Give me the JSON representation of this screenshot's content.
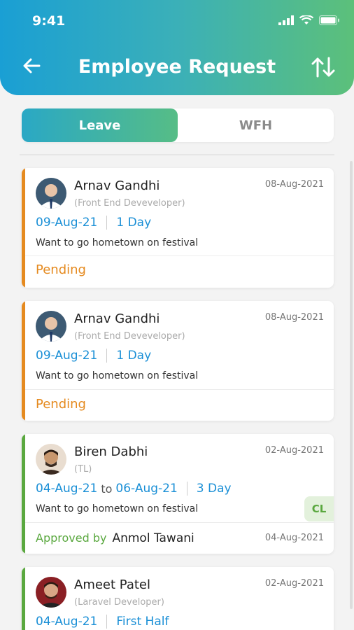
{
  "status_bar": {
    "time": "9:41"
  },
  "header": {
    "title": "Employee Request"
  },
  "tabs": [
    {
      "label": "Leave",
      "active": true
    },
    {
      "label": "WFH",
      "active": false
    }
  ],
  "colors": {
    "pending": "#e58a1f",
    "approved": "#5aa83f",
    "date_blue": "#1a8fd6"
  },
  "requests": [
    {
      "name": "Arnav Gandhi",
      "role": "(Front End Deveveloper)",
      "date": "08-Aug-2021",
      "start": "09-Aug-21",
      "duration": "1 Day",
      "reason": "Want to go hometown on festival",
      "status": "Pending"
    },
    {
      "name": "Arnav Gandhi",
      "role": "(Front End Deveveloper)",
      "date": "08-Aug-2021",
      "start": "09-Aug-21",
      "duration": "1 Day",
      "reason": "Want to go hometown on festival",
      "status": "Pending"
    },
    {
      "name": "Biren Dabhi",
      "role": "(TL)",
      "date": "02-Aug-2021",
      "start": "04-Aug-21",
      "to_word": "to",
      "end": "06-Aug-21",
      "duration": "3 Day",
      "reason": "Want to go hometown on festival",
      "badge": "CL",
      "status_label": "Approved by",
      "approver": "Anmol Tawani",
      "status_date": "04-Aug-2021"
    },
    {
      "name": "Ameet Patel",
      "role": "(Laravel Developer)",
      "date": "02-Aug-2021",
      "start": "04-Aug-21",
      "duration": "First Half"
    }
  ]
}
